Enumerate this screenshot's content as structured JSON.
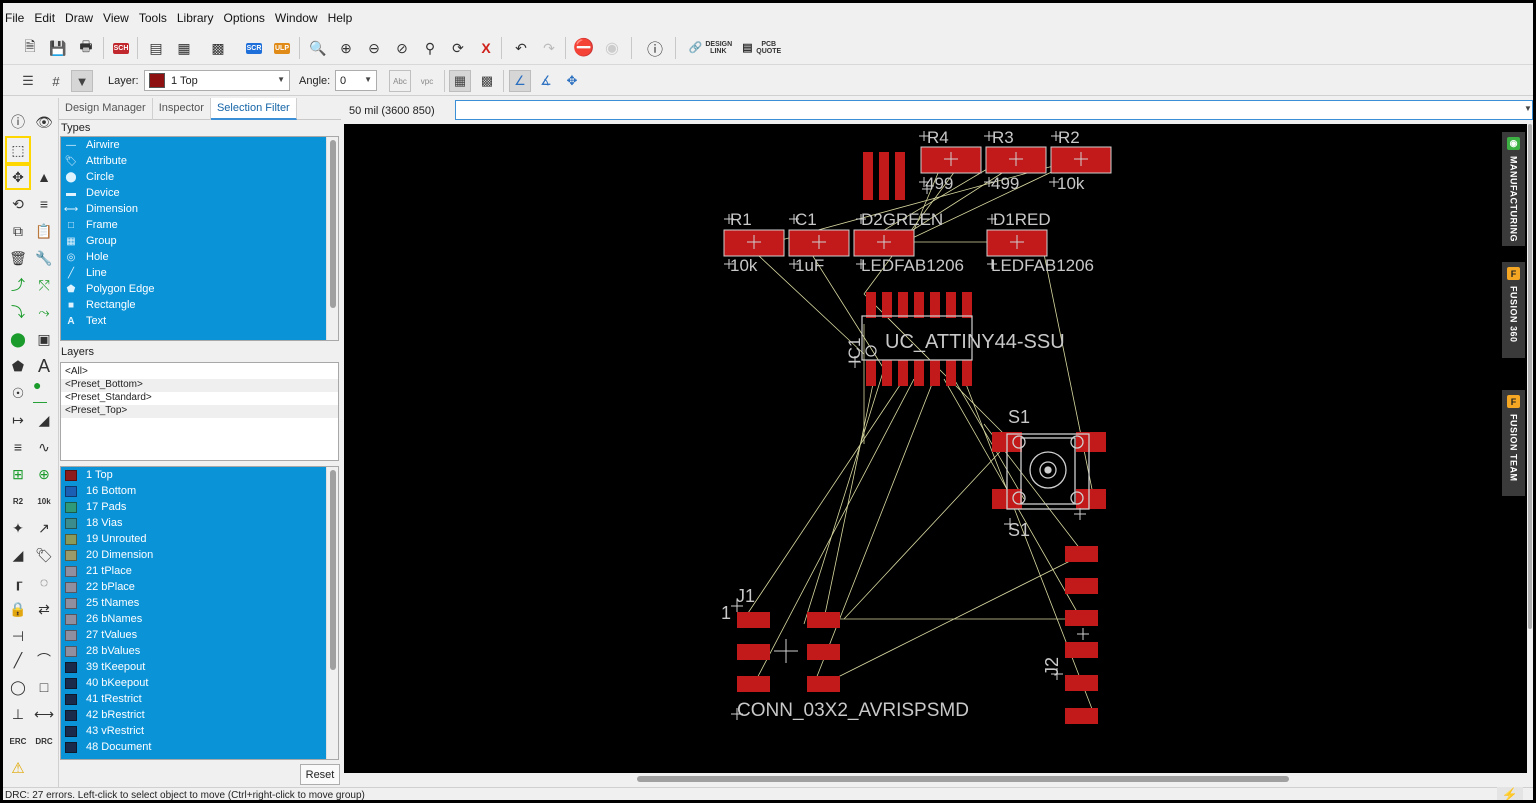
{
  "menu": [
    "File",
    "Edit",
    "Draw",
    "View",
    "Tools",
    "Library",
    "Options",
    "Window",
    "Help"
  ],
  "toolbar": {
    "sch": "SCH",
    "ulp": "ULP",
    "scr": "SCR",
    "design_link": "DESIGN LINK",
    "pcb_quote": "PCB QUOTE"
  },
  "params": {
    "layer_label": "Layer:",
    "layer_value": "1 Top",
    "angle_label": "Angle:",
    "angle_value": "0",
    "abc": "Abc",
    "vpc": "vpc"
  },
  "panel": {
    "tabs": [
      "Design Manager",
      "Inspector",
      "Selection Filter"
    ],
    "types_label": "Types",
    "types": [
      {
        "label": "Airwire",
        "icon": "airwire-icon"
      },
      {
        "label": "Attribute",
        "icon": "tag-icon"
      },
      {
        "label": "Circle",
        "icon": "circle-icon"
      },
      {
        "label": "Device",
        "icon": "device-icon"
      },
      {
        "label": "Dimension",
        "icon": "dimension-icon"
      },
      {
        "label": "Frame",
        "icon": "frame-icon"
      },
      {
        "label": "Group",
        "icon": "group-icon"
      },
      {
        "label": "Hole",
        "icon": "hole-icon"
      },
      {
        "label": "Line",
        "icon": "line-icon"
      },
      {
        "label": "Polygon Edge",
        "icon": "polygon-icon"
      },
      {
        "label": "Rectangle",
        "icon": "rectangle-icon"
      },
      {
        "label": "Text",
        "icon": "text-icon"
      }
    ],
    "layers_label": "Layers",
    "presets": [
      "<All>",
      "<Preset_Bottom>",
      "<Preset_Standard>",
      "<Preset_Top>"
    ],
    "layers": [
      {
        "label": "1 Top",
        "color": "#8e1b1b"
      },
      {
        "label": "16 Bottom",
        "color": "#1a5fb4"
      },
      {
        "label": "17 Pads",
        "color": "#2e9a7a"
      },
      {
        "label": "18 Vias",
        "color": "#3b8d8d"
      },
      {
        "label": "19 Unrouted",
        "color": "#8a9a5b"
      },
      {
        "label": "20 Dimension",
        "color": "#9a9a6a"
      },
      {
        "label": "21 tPlace",
        "color": "#8f8f9f"
      },
      {
        "label": "22 bPlace",
        "color": "#8f8f9f"
      },
      {
        "label": "25 tNames",
        "color": "#8f8f9f"
      },
      {
        "label": "26 bNames",
        "color": "#8f8f9f"
      },
      {
        "label": "27 tValues",
        "color": "#8f8f9f"
      },
      {
        "label": "28 bValues",
        "color": "#8f8f9f"
      },
      {
        "label": "39 tKeepout",
        "color": "#1a2a4a"
      },
      {
        "label": "40 bKeepout",
        "color": "#1a2a4a"
      },
      {
        "label": "41 tRestrict",
        "color": "#1a2a4a"
      },
      {
        "label": "42 bRestrict",
        "color": "#1a2a4a"
      },
      {
        "label": "43 vRestrict",
        "color": "#1a2a4a"
      },
      {
        "label": "48 Document",
        "color": "#1a2a4a"
      }
    ],
    "reset": "Reset"
  },
  "command": {
    "coords": "50 mil (3600 850)",
    "value": ""
  },
  "board": {
    "labels": {
      "r4": "R4",
      "r3": "R3",
      "r2": "R2",
      "r4v": "499",
      "r3v": "499",
      "r2v": "10k",
      "r1": "R1",
      "c1": "C1",
      "d2": "D2GREEN",
      "d1": "D1RED",
      "r1v": "10k",
      "c1v": "1uF",
      "d2v": "LEDFAB1206",
      "d1v": "LEDFAB1206",
      "ic1": "IC1",
      "ic1v": "UC_ATTINY44-SSU",
      "s1": "S1",
      "s1b": "S1",
      "j1": "J1",
      "j1pin": "1",
      "j1v": "CONN_03X2_AVRISPSMD",
      "j2": "J2"
    },
    "colors": {
      "pad": "#c21a1a",
      "text": "#c8c8c8",
      "airwire": "#d8d8a0",
      "outline": "#d0d0d0"
    }
  },
  "right_tabs": [
    "MANUFACTURING",
    "FUSION 360",
    "FUSION TEAM"
  ],
  "status": "DRC: 27 errors. Left-click to select object to move (Ctrl+right-click to move group)"
}
